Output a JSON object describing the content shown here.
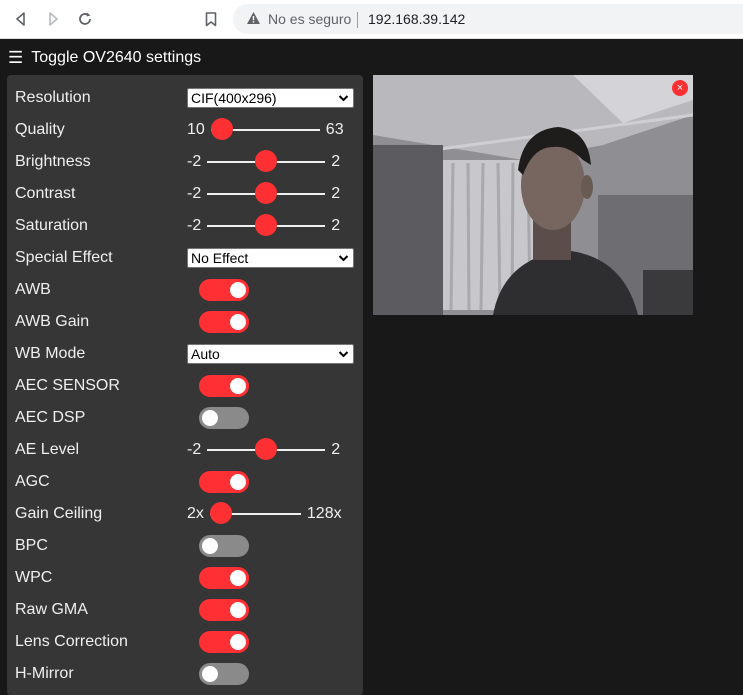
{
  "browser": {
    "security_label": "No es seguro",
    "url": "192.168.39.142"
  },
  "header": {
    "toggle_label": "Toggle OV2640 settings"
  },
  "settings": [
    {
      "label": "Resolution",
      "type": "select",
      "value": "CIF(400x296)"
    },
    {
      "label": "Quality",
      "type": "range",
      "min": "10",
      "max": "63",
      "level": 0.0
    },
    {
      "label": "Brightness",
      "type": "range",
      "min": "-2",
      "max": "2",
      "level": 0.5
    },
    {
      "label": "Contrast",
      "type": "range",
      "min": "-2",
      "max": "2",
      "level": 0.5
    },
    {
      "label": "Saturation",
      "type": "range",
      "min": "-2",
      "max": "2",
      "level": 0.5
    },
    {
      "label": "Special Effect",
      "type": "select",
      "value": "No Effect"
    },
    {
      "label": "AWB",
      "type": "switch",
      "checked": true
    },
    {
      "label": "AWB Gain",
      "type": "switch",
      "checked": true
    },
    {
      "label": "WB Mode",
      "type": "select",
      "value": "Auto"
    },
    {
      "label": "AEC SENSOR",
      "type": "switch",
      "checked": true
    },
    {
      "label": "AEC DSP",
      "type": "switch",
      "checked": false
    },
    {
      "label": "AE Level",
      "type": "range",
      "min": "-2",
      "max": "2",
      "level": 0.5
    },
    {
      "label": "AGC",
      "type": "switch",
      "checked": true
    },
    {
      "label": "Gain Ceiling",
      "type": "range",
      "min": "2x",
      "max": "128x",
      "level": 0.0
    },
    {
      "label": "BPC",
      "type": "switch",
      "checked": false
    },
    {
      "label": "WPC",
      "type": "switch",
      "checked": true
    },
    {
      "label": "Raw GMA",
      "type": "switch",
      "checked": true
    },
    {
      "label": "Lens Correction",
      "type": "switch",
      "checked": true
    },
    {
      "label": "H-Mirror",
      "type": "switch",
      "checked": false
    }
  ],
  "stream": {
    "close_label": "×"
  },
  "colors": {
    "accent": "#ff3034",
    "panel": "#363636",
    "background": "#181818"
  }
}
